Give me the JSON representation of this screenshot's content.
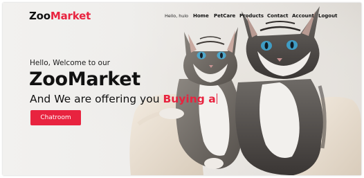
{
  "brand": {
    "part1": "Zoo",
    "part2": "Market"
  },
  "nav": {
    "user": "Hello, hulo",
    "items": [
      "Home",
      "PetCare",
      "Products",
      "Contact",
      "Account",
      "Logout"
    ]
  },
  "hero": {
    "greeting": "Hello, Welcome to our",
    "title": "ZooMarket",
    "offer_prefix": "And We are offering you",
    "offer_typed": "Buying a",
    "button": "Chatroom"
  },
  "colors": {
    "accent": "#e8233f",
    "text": "#111111"
  }
}
